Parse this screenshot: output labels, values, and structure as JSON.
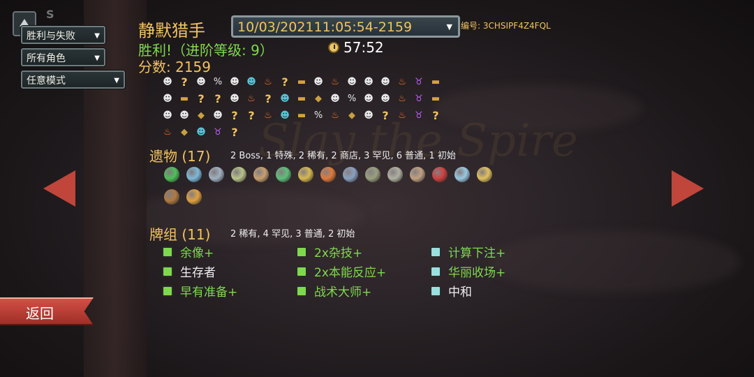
{
  "filters": {
    "result": "胜利与失败",
    "character": "所有角色",
    "mode": "任意模式"
  },
  "corner_letter": "S",
  "player_name": "静默猎手",
  "run_selector": "10/03/202111:05:54-2159",
  "seed_label": "编号: 3CHSIPF4Z4FQL",
  "victory_text": "胜利!（进阶等级: 9）",
  "timer": "57:52",
  "score_text": "分数: 2159",
  "background_logo": "Slay the Spire",
  "path": [
    [
      "monster",
      "unknown",
      "monster",
      "event-treasure",
      "monster",
      "elite",
      "rest",
      "unknown",
      "chest",
      "monster",
      "rest",
      "monster",
      "monster",
      "monster",
      "rest",
      "boss",
      "chest"
    ],
    [
      "monster",
      "chest",
      "unknown",
      "unknown",
      "monster",
      "rest",
      "unknown",
      "elite",
      "chest",
      "shop",
      "monster",
      "event-treasure",
      "monster",
      "monster",
      "rest",
      "boss",
      "chest"
    ],
    [
      "monster",
      "monster",
      "shop",
      "monster",
      "unknown",
      "unknown",
      "rest",
      "elite",
      "chest",
      "event-treasure",
      "rest",
      "shop",
      "monster",
      "unknown",
      "rest",
      "boss",
      "unknown"
    ],
    [
      "rest",
      "shop",
      "elite",
      "boss",
      "unknown"
    ]
  ],
  "relics": {
    "title": "遗物",
    "count": "(17)",
    "summary": "2  Boss, 1  特殊, 2  稀有, 2  商店, 3  罕见, 6  普通, 1  初始",
    "items": [
      "ring-of-the-serpent",
      "tingsha",
      "anchor",
      "bag-of-preparation",
      "kunai",
      "cursed-key",
      "letter-opener",
      "bottled-flame",
      "ships-wheel",
      "pantograph",
      "bird-cage",
      "mummified-hand",
      "red-mask",
      "tube",
      "hook",
      "abacus",
      "potted-flower"
    ]
  },
  "deck": {
    "title": "牌组",
    "count": "(11)",
    "summary": "2  稀有, 4  罕见, 3  普通, 2  初始",
    "cards": [
      {
        "name": "余像+",
        "upgraded": true,
        "color": "#7fd94e"
      },
      {
        "name": "2x杂技+",
        "upgraded": true,
        "color": "#7fd94e"
      },
      {
        "name": "计算下注+",
        "upgraded": true,
        "color": "#7fd94e"
      },
      {
        "name": "生存者",
        "upgraded": false,
        "color": "#f0f0f0"
      },
      {
        "name": "2x本能反应+",
        "upgraded": true,
        "color": "#7fd94e"
      },
      {
        "name": "华丽收场+",
        "upgraded": true,
        "color": "#7fd94e"
      },
      {
        "name": "早有准备+",
        "upgraded": true,
        "color": "#7fd94e"
      },
      {
        "name": "战术大师+",
        "upgraded": true,
        "color": "#7fd94e"
      },
      {
        "name": "中和",
        "upgraded": false,
        "color": "#f0f0f0"
      }
    ]
  },
  "back_label": "返回",
  "colors": {
    "gold": "#f2c35f",
    "green": "#7fd94e",
    "arrow_red": "#c0453b"
  }
}
